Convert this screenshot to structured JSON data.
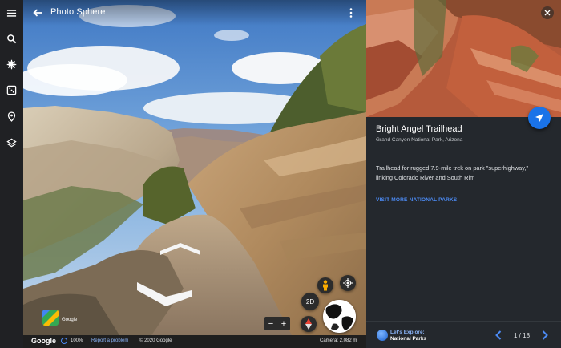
{
  "rail": {
    "items": [
      {
        "icon": "menu-icon"
      },
      {
        "icon": "search-icon"
      },
      {
        "icon": "ship-wheel-icon"
      },
      {
        "icon": "dice-icon"
      },
      {
        "icon": "location-pin-icon"
      },
      {
        "icon": "layers-icon"
      }
    ]
  },
  "viewer": {
    "title": "Photo Sphere",
    "back_icon": "arrow-back-icon",
    "more_icon": "more-vert-icon",
    "view_toggle": "2D",
    "zoom_out": "−",
    "zoom_in": "+",
    "mini_label": "Google"
  },
  "statusbar": {
    "brand": "Google",
    "zoom": "100%",
    "report": "Report a problem",
    "copyright": "© 2020 Google",
    "camera": "Camera: 2,082 m"
  },
  "panel": {
    "title": "Bright Angel Trailhead",
    "subtitle": "Grand Canyon National Park, Arizona",
    "description": "Trailhead for rugged 7.9-mile trek on park \"superhighway,\" linking Colorado River and South Rim",
    "link": "VISIT MORE NATIONAL PARKS",
    "tour_line1": "Let's Explore:",
    "tour_line2": "National Parks",
    "page": "1 / 18",
    "accent": "#1a73e8"
  }
}
